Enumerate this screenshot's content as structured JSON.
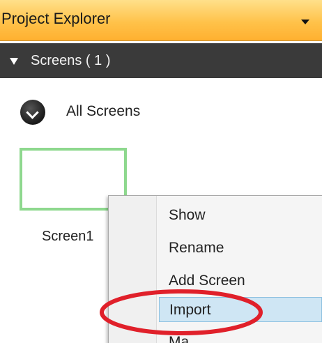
{
  "titlebar": {
    "title": "Project Explorer",
    "dropdown_icon": "chevron-down-icon"
  },
  "section": {
    "label": "Screens ( 1 )",
    "expand_icon": "triangle-down-icon"
  },
  "all_screens": {
    "label": "All Screens",
    "icon": "circle-chevron-down-icon"
  },
  "screens": [
    {
      "name": "Screen1"
    }
  ],
  "context_menu": {
    "items": [
      {
        "label": "Show"
      },
      {
        "label": "Rename"
      },
      {
        "label": "Add Screen"
      },
      {
        "label": "Import",
        "highlighted": true
      },
      {
        "label": "Ma..."
      }
    ]
  },
  "colors": {
    "titlebar": "#ffc24a",
    "section_header": "#3a3a3a",
    "thumbnail_border": "#8ed88e",
    "menu_highlight": "#cfe6f4",
    "annotation": "#e0202a"
  }
}
